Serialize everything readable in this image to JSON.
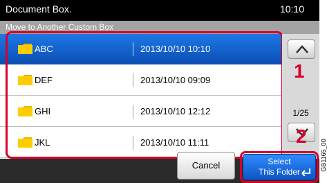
{
  "header": {
    "title": "Document Box.",
    "clock": "10:10"
  },
  "subheader": {
    "title": "Move to Another Custom Box"
  },
  "list": {
    "rows": [
      {
        "name": "ABC",
        "date": "2013/10/10 10:10",
        "selected": true,
        "icon": "folder-icon"
      },
      {
        "name": "DEF",
        "date": "2013/10/10 09:09",
        "selected": false,
        "icon": "folder-icon"
      },
      {
        "name": "GHI",
        "date": "2013/10/10 12:12",
        "selected": false,
        "icon": "folder-icon"
      },
      {
        "name": "JKL",
        "date": "2013/10/10 11:11",
        "selected": false,
        "icon": "folder-icon"
      }
    ]
  },
  "pager": {
    "indicator": "1/25",
    "up_icon": "chevron-up-icon",
    "down_icon": "chevron-down-icon"
  },
  "callouts": {
    "list": "1",
    "pager": "2"
  },
  "footer": {
    "cancel_label": "Cancel",
    "select_label_line1": "Select",
    "select_label_line2": "This Folder",
    "enter_icon": "enter-icon"
  },
  "figure_code": "GB1165_00",
  "colors": {
    "selected_row": "#1565d8",
    "callout": "#d6002a",
    "title_bar": "#000000",
    "subtitle_bar": "#a3a3a3"
  }
}
